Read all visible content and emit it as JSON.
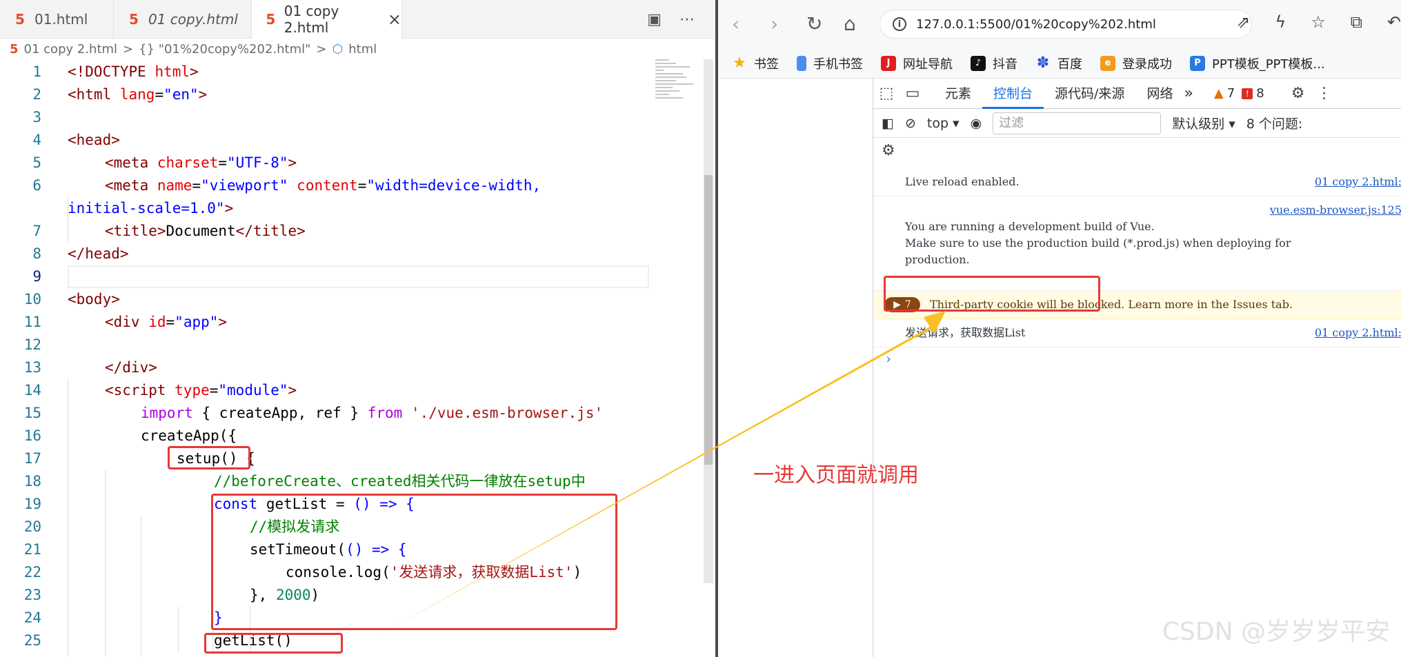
{
  "editor": {
    "tabs": [
      {
        "label": "01.html",
        "icon": "html5-icon",
        "italic": false,
        "active": false
      },
      {
        "label": "01 copy.html",
        "icon": "html5-icon",
        "italic": true,
        "active": false
      },
      {
        "label": "01 copy 2.html",
        "icon": "html5-icon",
        "italic": false,
        "active": true
      }
    ],
    "close_glyph": "×",
    "actions": [
      "split-editor-icon",
      "more-icon"
    ],
    "breadcrumb": {
      "file": "01 copy 2.html",
      "sep1": ">",
      "scope": "{} \"01%20copy%202.html\"",
      "sep2": ">",
      "node": "html"
    },
    "lines": [
      {
        "n": "1"
      },
      {
        "n": "2"
      },
      {
        "n": "3"
      },
      {
        "n": "4"
      },
      {
        "n": "5"
      },
      {
        "n": "6"
      },
      {
        "n": ""
      },
      {
        "n": "7"
      },
      {
        "n": "8"
      },
      {
        "n": "9"
      },
      {
        "n": "10"
      },
      {
        "n": "11"
      },
      {
        "n": "12"
      },
      {
        "n": "13"
      },
      {
        "n": "14"
      },
      {
        "n": "15"
      },
      {
        "n": "16"
      },
      {
        "n": "17"
      },
      {
        "n": "18"
      },
      {
        "n": "19"
      },
      {
        "n": "20"
      },
      {
        "n": "21"
      },
      {
        "n": "22"
      },
      {
        "n": "23"
      },
      {
        "n": "24"
      },
      {
        "n": "25"
      }
    ],
    "code": {
      "l1a": "<!DOCTYPE",
      "l1b": " html",
      "l1c": ">",
      "l2a": "<html",
      "l2b": " lang",
      "l2c": "=",
      "l2d": "\"en\"",
      "l2e": ">",
      "l4": "<head>",
      "l5a": "<meta",
      "l5b": " charset",
      "l5c": "=",
      "l5d": "\"UTF-8\"",
      "l5e": ">",
      "l6a": "<meta",
      "l6b": " name",
      "l6c": "=",
      "l6d": "\"viewport\"",
      "l6e": " content",
      "l6f": "=",
      "l6g": "\"width=device-width,",
      "l6h": "initial-scale=1.0\"",
      "l6i": ">",
      "l7a": "<title>",
      "l7b": "Document",
      "l7c": "</title>",
      "l8": "</head>",
      "l10": "<body>",
      "l11a": "<div",
      "l11b": " id",
      "l11c": "=",
      "l11d": "\"app\"",
      "l11e": ">",
      "l13": "</div>",
      "l14a": "<script",
      "l14b": " type",
      "l14c": "=",
      "l14d": "\"module\"",
      "l14e": ">",
      "l15a": "import",
      "l15b": " { createApp, ref } ",
      "l15c": "from",
      "l15d": " './vue.esm-browser.js'",
      "l16a": "createApp",
      "l16b": "({",
      "l17a": "setup() ",
      "l17b": "{",
      "l18": "//beforeCreate、created相关代码一律放在setup中",
      "l19a": "const",
      "l19b": " getList = ",
      "l19c": "() => {",
      "l20": "//模拟发请求",
      "l21a": "setTimeout(",
      "l21b": "() => {",
      "l22a": "console.log(",
      "l22b": "'发送请求，获取数据List'",
      "l22c": ")",
      "l23a": "}, ",
      "l23b": "2000",
      "l23c": ")",
      "l24": "}",
      "l25": "getList()"
    }
  },
  "browser": {
    "nav": [
      "back-icon",
      "forward-icon",
      "reload-icon",
      "home-icon"
    ],
    "url": "127.0.0.1:5500/01%20copy%202.html",
    "toolbar_icons": [
      "share-icon",
      "bolt-icon",
      "star-icon",
      "extensions-icon",
      "undo-icon"
    ],
    "bookmarks": [
      {
        "label": "书签",
        "icon_color": "#f4b400",
        "glyph": "★"
      },
      {
        "label": "手机书签",
        "icon_color": "#4a8ff0",
        "glyph": "▮"
      },
      {
        "label": "网址导航",
        "icon_color": "#e02020",
        "glyph": "J"
      },
      {
        "label": "抖音",
        "icon_color": "#111111",
        "glyph": "♪"
      },
      {
        "label": "百度",
        "icon_color": "#2a52d6",
        "glyph": "✽"
      },
      {
        "label": "登录成功",
        "icon_color": "#f29b1d",
        "glyph": "e"
      },
      {
        "label": "PPT模板_PPT模板...",
        "icon_color": "#2a7ae2",
        "glyph": "P"
      }
    ],
    "devtools": {
      "tabs": [
        "元素",
        "控制台",
        "源代码/来源",
        "网络"
      ],
      "active_tab": "控制台",
      "more": "»",
      "warnings": "7",
      "errors": "8",
      "context": "top",
      "filter_placeholder": "过滤",
      "level": "默认级别",
      "issues": "8 个问题:",
      "messages": [
        {
          "text": "Live reload enabled.",
          "src": "01 copy 2.html:"
        },
        {
          "text": "You are running a development build of Vue.\nMake sure to use the production build (*.prod.js) when deploying for\nproduction.",
          "src": "vue.esm-browser.js:125"
        }
      ],
      "warning_row": {
        "count": "7",
        "text": "Third-party cookie will be blocked. Learn more in the Issues tab."
      },
      "log_row": {
        "text": "发送请求，获取数据List",
        "src": "01 copy 2.html:"
      },
      "prompt": "›"
    }
  },
  "annotation": {
    "text": "一进入页面就调用",
    "color": "#e53935",
    "arrow_color": "#fbbf24"
  },
  "watermark": "CSDN @岁岁岁平安"
}
